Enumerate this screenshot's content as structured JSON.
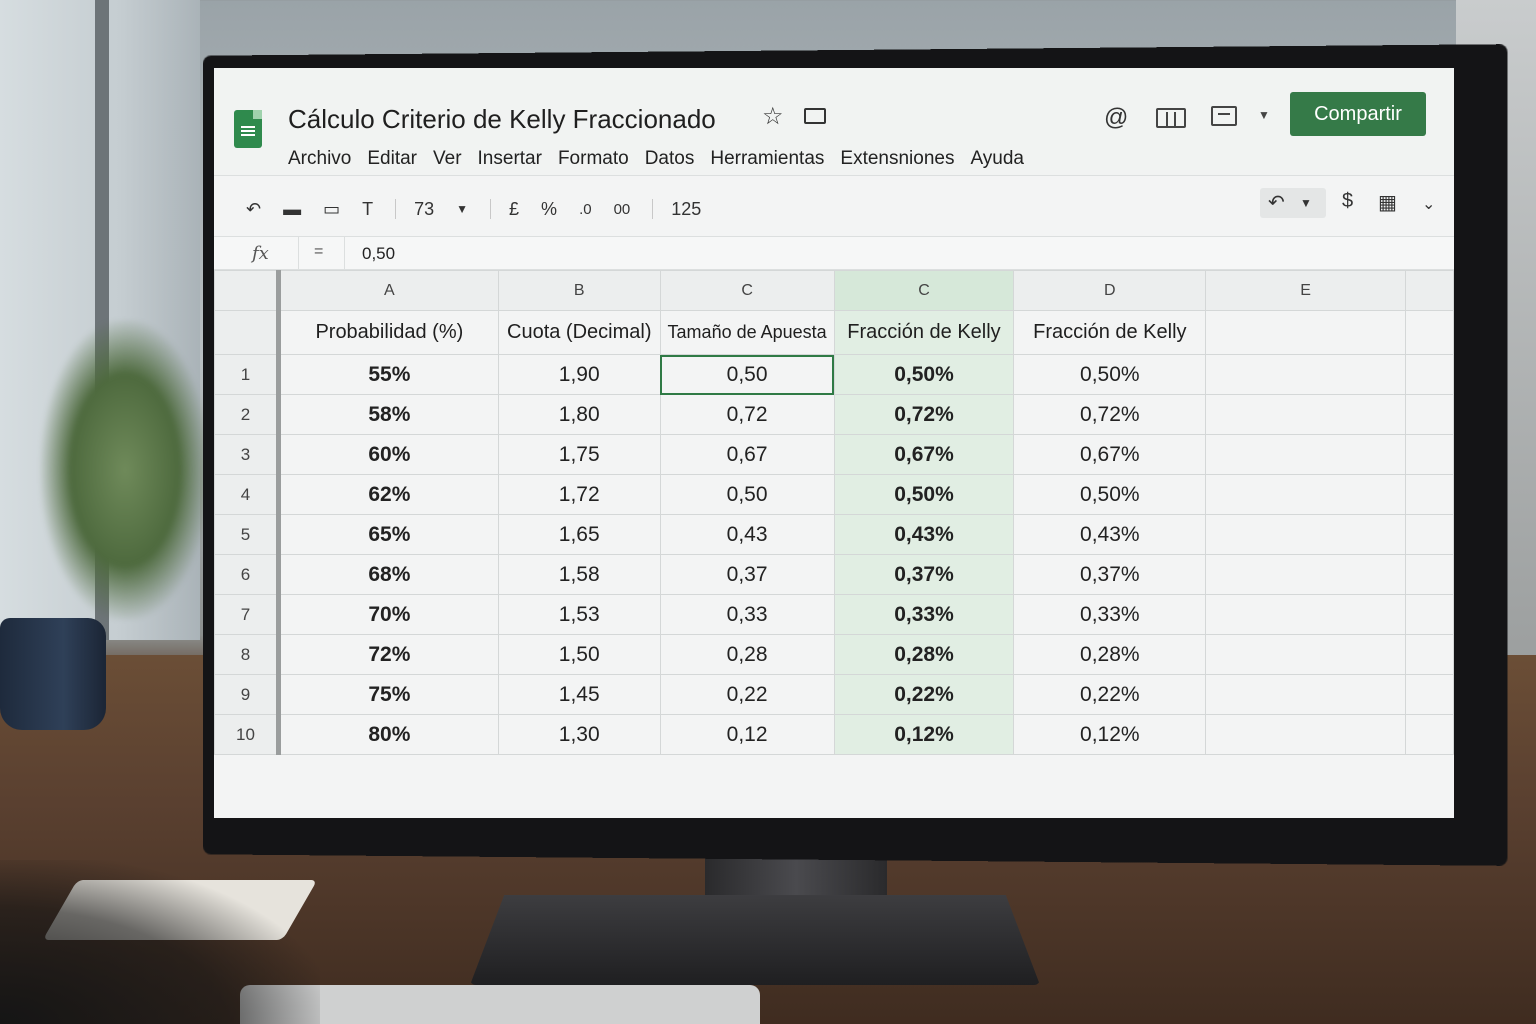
{
  "app": {
    "title": "Cálculo Criterio de Kelly Fraccionado",
    "share_label": "Compartir",
    "accent_color": "#357a48",
    "icons": [
      "sheets-doc-icon",
      "star-icon",
      "folder-icon",
      "at-icon",
      "chart-icon",
      "comment-icon",
      "chevron-down-icon"
    ]
  },
  "menu": {
    "items": [
      "Archivo",
      "Editar",
      "Ver",
      "Insertar",
      "Formato",
      "Datos",
      "Herramientas",
      "Extensniones",
      "Ayuda"
    ]
  },
  "toolbar": {
    "zoom": "73",
    "currency": "£",
    "percent": "%",
    "decrease_decimals": ".0",
    "increase_decimals": "00",
    "font_size": "125",
    "dollar": "$"
  },
  "formula_bar": {
    "fx": "fx",
    "eq": "=",
    "value": "0,50"
  },
  "sheet": {
    "column_letters": [
      "A",
      "B",
      "C",
      "C",
      "D",
      "E"
    ],
    "headers": [
      "Probabilidad (%)",
      "Cuota (Decimal)",
      "Tamaño de Apuesta",
      "Fracción de Kelly",
      "Fracción de Kelly",
      ""
    ],
    "rows": [
      {
        "n": "1",
        "a": "55%",
        "b": "1,90",
        "c": "0,50",
        "d": "0,50%",
        "e": "0,50%"
      },
      {
        "n": "2",
        "a": "58%",
        "b": "1,80",
        "c": "0,72",
        "d": "0,72%",
        "e": "0,72%"
      },
      {
        "n": "3",
        "a": "60%",
        "b": "1,75",
        "c": "0,67",
        "d": "0,67%",
        "e": "0,67%"
      },
      {
        "n": "4",
        "a": "62%",
        "b": "1,72",
        "c": "0,50",
        "d": "0,50%",
        "e": "0,50%"
      },
      {
        "n": "5",
        "a": "65%",
        "b": "1,65",
        "c": "0,43",
        "d": "0,43%",
        "e": "0,43%"
      },
      {
        "n": "6",
        "a": "68%",
        "b": "1,58",
        "c": "0,37",
        "d": "0,37%",
        "e": "0,37%"
      },
      {
        "n": "7",
        "a": "70%",
        "b": "1,53",
        "c": "0,33",
        "d": "0,33%",
        "e": "0,33%"
      },
      {
        "n": "8",
        "a": "72%",
        "b": "1,50",
        "c": "0,28",
        "d": "0,28%",
        "e": "0,28%"
      },
      {
        "n": "9",
        "a": "75%",
        "b": "1,45",
        "c": "0,22",
        "d": "0,22%",
        "e": "0,22%"
      },
      {
        "n": "10",
        "a": "80%",
        "b": "1,30",
        "c": "0,12",
        "d": "0,12%",
        "e": "0,12%"
      }
    ],
    "selected_cell": "C1",
    "highlight_color": "#e1eee3"
  }
}
